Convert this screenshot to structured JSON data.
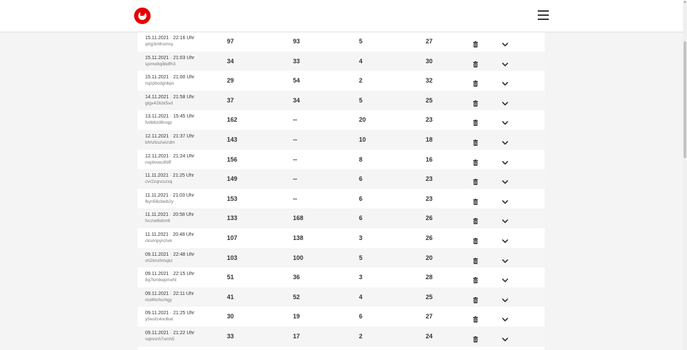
{
  "header": {
    "logo": "vodafone-logo",
    "menu_icon": "hamburger-icon"
  },
  "rows": [
    {
      "date": "15.11.2021",
      "time": "22:16 Uhr",
      "id": "qrtg3mthsmxy",
      "v1": "97",
      "v2": "93",
      "v3": "5",
      "v4": "27"
    },
    {
      "date": "15.11.2021",
      "time": "21:03 Uhr",
      "id": "spmw8q8bdfh3",
      "v1": "34",
      "v2": "33",
      "v3": "4",
      "v4": "30"
    },
    {
      "date": "15.11.2021",
      "time": "21:00 Uhr",
      "id": "nqzpbcdgnbps",
      "v1": "29",
      "v2": "54",
      "v3": "2",
      "v4": "32"
    },
    {
      "date": "14.11.2021",
      "time": "21:58 Uhr",
      "id": "gtgx426zk5vd",
      "v1": "37",
      "v2": "34",
      "v3": "5",
      "v4": "25"
    },
    {
      "date": "13.11.2021",
      "time": "15:45 Uhr",
      "id": "fvdb6zd8rsqp",
      "v1": "162",
      "v2": "--",
      "v3": "20",
      "v4": "23"
    },
    {
      "date": "12.11.2021",
      "time": "21:37 Uhr",
      "id": "bhhzbszwcrdm",
      "v1": "143",
      "v2": "--",
      "v3": "10",
      "v4": "18"
    },
    {
      "date": "12.11.2021",
      "time": "21:24 Uhr",
      "id": "nxpbvwcdfdff",
      "v1": "156",
      "v2": "--",
      "v3": "8",
      "v4": "16"
    },
    {
      "date": "11.11.2021",
      "time": "21:25 Uhr",
      "id": "cvr2zqncszxq",
      "v1": "149",
      "v2": "--",
      "v3": "6",
      "v4": "23"
    },
    {
      "date": "11.11.2021",
      "time": "21:03 Uhr",
      "id": "fkyn56cbwb2y",
      "v1": "153",
      "v2": "--",
      "v3": "6",
      "v4": "23"
    },
    {
      "date": "11.11.2021",
      "time": "20:58 Uhr",
      "id": "fvczwt6dmr6",
      "v1": "133",
      "v2": "168",
      "v3": "6",
      "v4": "26"
    },
    {
      "date": "11.11.2021",
      "time": "20:48 Uhr",
      "id": "cksnnpyrchxk",
      "v1": "107",
      "v2": "138",
      "v3": "3",
      "v4": "26"
    },
    {
      "date": "09.11.2021",
      "time": "22:48 Uhr",
      "id": "vh2tmzfnhqkz",
      "v1": "103",
      "v2": "100",
      "v3": "5",
      "v4": "20"
    },
    {
      "date": "09.11.2021",
      "time": "22:15 Uhr",
      "id": "8q7kmbwpmxht",
      "v1": "51",
      "v2": "36",
      "v3": "3",
      "v4": "28"
    },
    {
      "date": "09.11.2021",
      "time": "22:11 Uhr",
      "id": "md4hchcrhgy",
      "v1": "41",
      "v2": "52",
      "v3": "4",
      "v4": "25"
    },
    {
      "date": "09.11.2021",
      "time": "21:25 Uhr",
      "id": "y5wsfc4nn6wt",
      "v1": "30",
      "v2": "19",
      "v3": "6",
      "v4": "27"
    },
    {
      "date": "09.11.2021",
      "time": "21:22 Uhr",
      "id": "vqtnnnh7xmh5",
      "v1": "33",
      "v2": "17",
      "v3": "2",
      "v4": "24"
    }
  ],
  "row_separator": "·",
  "colors": {
    "brand": "#e60000",
    "text": "#333333",
    "muted": "#777777"
  }
}
